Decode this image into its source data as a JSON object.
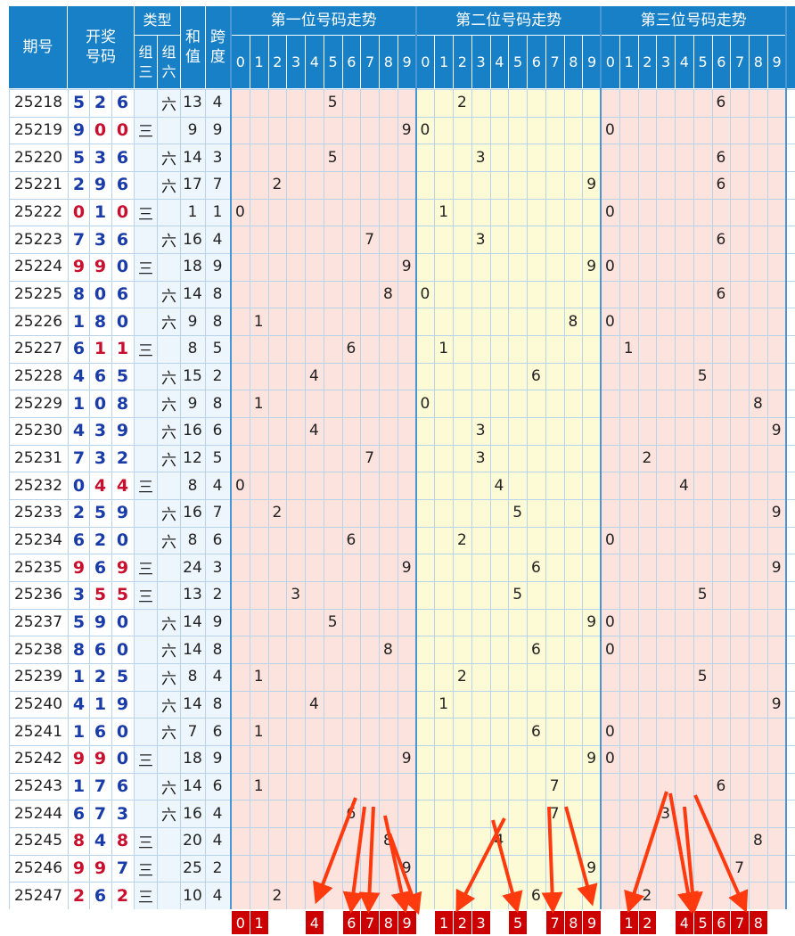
{
  "header": {
    "period_label": "期号",
    "draw_label_1": "开奖",
    "draw_label_2": "号码",
    "type_label": "类型",
    "type_group3_label": "组三",
    "type_group6_label": "组六",
    "sum_label": "和值",
    "span_label": "跨度",
    "position_titles": [
      "第一位号码走势",
      "第二位号码走势",
      "第三位号码走势"
    ],
    "digit_labels": [
      "0",
      "1",
      "2",
      "3",
      "4",
      "5",
      "6",
      "7",
      "8",
      "9"
    ]
  },
  "type_marks": {
    "group3": "三",
    "group6": "六"
  },
  "colors": {
    "header_bg": "#1780c6",
    "repeat_digit": "#c8102e",
    "normal_digit": "#1a3ca8",
    "zone_pink": "#fde3de",
    "zone_yellow": "#fdfbd6",
    "selection_red": "#cc0000",
    "arrow_red": "#ff3a0f"
  },
  "chart_data": {
    "type": "table",
    "title": "第一位号码走势 / 第二位号码走势 / 第三位号码走势",
    "rows": [
      {
        "period": "25218",
        "digits": [
          "5",
          "2",
          "6"
        ],
        "type": "六",
        "sum": "13",
        "span": "4"
      },
      {
        "period": "25219",
        "digits": [
          "9",
          "0",
          "0"
        ],
        "type": "三",
        "sum": "9",
        "span": "9"
      },
      {
        "period": "25220",
        "digits": [
          "5",
          "3",
          "6"
        ],
        "type": "六",
        "sum": "14",
        "span": "3"
      },
      {
        "period": "25221",
        "digits": [
          "2",
          "9",
          "6"
        ],
        "type": "六",
        "sum": "17",
        "span": "7"
      },
      {
        "period": "25222",
        "digits": [
          "0",
          "1",
          "0"
        ],
        "type": "三",
        "sum": "1",
        "span": "1"
      },
      {
        "period": "25223",
        "digits": [
          "7",
          "3",
          "6"
        ],
        "type": "六",
        "sum": "16",
        "span": "4"
      },
      {
        "period": "25224",
        "digits": [
          "9",
          "9",
          "0"
        ],
        "type": "三",
        "sum": "18",
        "span": "9"
      },
      {
        "period": "25225",
        "digits": [
          "8",
          "0",
          "6"
        ],
        "type": "六",
        "sum": "14",
        "span": "8"
      },
      {
        "period": "25226",
        "digits": [
          "1",
          "8",
          "0"
        ],
        "type": "六",
        "sum": "9",
        "span": "8"
      },
      {
        "period": "25227",
        "digits": [
          "6",
          "1",
          "1"
        ],
        "type": "三",
        "sum": "8",
        "span": "5"
      },
      {
        "period": "25228",
        "digits": [
          "4",
          "6",
          "5"
        ],
        "type": "六",
        "sum": "15",
        "span": "2"
      },
      {
        "period": "25229",
        "digits": [
          "1",
          "0",
          "8"
        ],
        "type": "六",
        "sum": "9",
        "span": "8"
      },
      {
        "period": "25230",
        "digits": [
          "4",
          "3",
          "9"
        ],
        "type": "六",
        "sum": "16",
        "span": "6"
      },
      {
        "period": "25231",
        "digits": [
          "7",
          "3",
          "2"
        ],
        "type": "六",
        "sum": "12",
        "span": "5"
      },
      {
        "period": "25232",
        "digits": [
          "0",
          "4",
          "4"
        ],
        "type": "三",
        "sum": "8",
        "span": "4"
      },
      {
        "period": "25233",
        "digits": [
          "2",
          "5",
          "9"
        ],
        "type": "六",
        "sum": "16",
        "span": "7"
      },
      {
        "period": "25234",
        "digits": [
          "6",
          "2",
          "0"
        ],
        "type": "六",
        "sum": "8",
        "span": "6"
      },
      {
        "period": "25235",
        "digits": [
          "9",
          "6",
          "9"
        ],
        "type": "三",
        "sum": "24",
        "span": "3"
      },
      {
        "period": "25236",
        "digits": [
          "3",
          "5",
          "5"
        ],
        "type": "三",
        "sum": "13",
        "span": "2"
      },
      {
        "period": "25237",
        "digits": [
          "5",
          "9",
          "0"
        ],
        "type": "六",
        "sum": "14",
        "span": "9"
      },
      {
        "period": "25238",
        "digits": [
          "8",
          "6",
          "0"
        ],
        "type": "六",
        "sum": "14",
        "span": "8"
      },
      {
        "period": "25239",
        "digits": [
          "1",
          "2",
          "5"
        ],
        "type": "六",
        "sum": "8",
        "span": "4"
      },
      {
        "period": "25240",
        "digits": [
          "4",
          "1",
          "9"
        ],
        "type": "六",
        "sum": "14",
        "span": "8"
      },
      {
        "period": "25241",
        "digits": [
          "1",
          "6",
          "0"
        ],
        "type": "六",
        "sum": "7",
        "span": "6"
      },
      {
        "period": "25242",
        "digits": [
          "9",
          "9",
          "0"
        ],
        "type": "三",
        "sum": "18",
        "span": "9"
      },
      {
        "period": "25243",
        "digits": [
          "1",
          "7",
          "6"
        ],
        "type": "六",
        "sum": "14",
        "span": "6"
      },
      {
        "period": "25244",
        "digits": [
          "6",
          "7",
          "3"
        ],
        "type": "六",
        "sum": "16",
        "span": "4"
      },
      {
        "period": "25245",
        "digits": [
          "8",
          "4",
          "8"
        ],
        "type": "三",
        "sum": "20",
        "span": "4"
      },
      {
        "period": "25246",
        "digits": [
          "9",
          "9",
          "7"
        ],
        "type": "三",
        "sum": "25",
        "span": "2"
      },
      {
        "period": "25247",
        "digits": [
          "2",
          "6",
          "2"
        ],
        "type": "三",
        "sum": "10",
        "span": "4"
      }
    ],
    "selection": {
      "position_1": [
        "0",
        "1",
        "4",
        "6",
        "7",
        "8",
        "9"
      ],
      "position_2": [
        "1",
        "2",
        "3",
        "5",
        "7",
        "8",
        "9"
      ],
      "position_3": [
        "1",
        "2",
        "4",
        "5",
        "6",
        "7",
        "8"
      ]
    }
  }
}
